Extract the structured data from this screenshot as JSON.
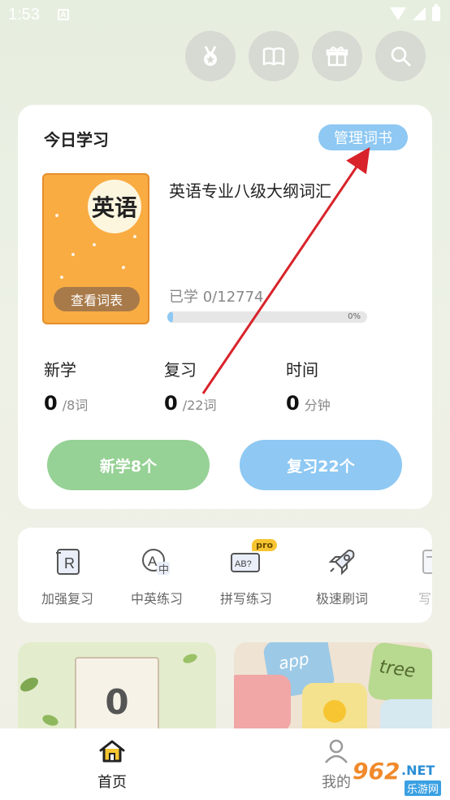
{
  "status_bar": {
    "time": "1:53",
    "notification": "A"
  },
  "header": {
    "icons": [
      "medal-icon",
      "book-icon",
      "gift-icon",
      "search-icon"
    ]
  },
  "today": {
    "title": "今日学习",
    "manage_label": "管理词书",
    "book": {
      "cover_title": "英语",
      "view_list_label": "查看词表",
      "name": "英语专业八级大纲词汇",
      "learned_text": "已学 0/12774",
      "progress_fraction": 0,
      "progress_label": "0%"
    },
    "stats": [
      {
        "label": "新学",
        "value": "0",
        "unit": "/8词"
      },
      {
        "label": "复习",
        "value": "0",
        "unit": "/22词"
      },
      {
        "label": "时间",
        "value": "0",
        "unit": "分钟"
      }
    ],
    "new_button": "新学8个",
    "review_button": "复习22个"
  },
  "tools": [
    {
      "label": "加强复习",
      "icon": "review-r-icon"
    },
    {
      "label": "中英练习",
      "icon": "translate-icon"
    },
    {
      "label": "拼写练习",
      "icon": "spelling-icon",
      "badge": "pro"
    },
    {
      "label": "极速刷词",
      "icon": "rocket-icon"
    },
    {
      "label": "写作",
      "icon": "writing-icon"
    }
  ],
  "banners": {
    "calendar_number": "0",
    "tile_words": [
      "app",
      "tree"
    ]
  },
  "tab_bar": {
    "home_label": "首页",
    "me_label": "我的"
  },
  "watermark": {
    "number": "962",
    "domain": ".NET",
    "name": "乐游网"
  },
  "colors": {
    "accent_blue": "#8ec8f3",
    "accent_green": "#96d195",
    "book_orange": "#f9ac42",
    "arrow_red": "#d8232a"
  }
}
